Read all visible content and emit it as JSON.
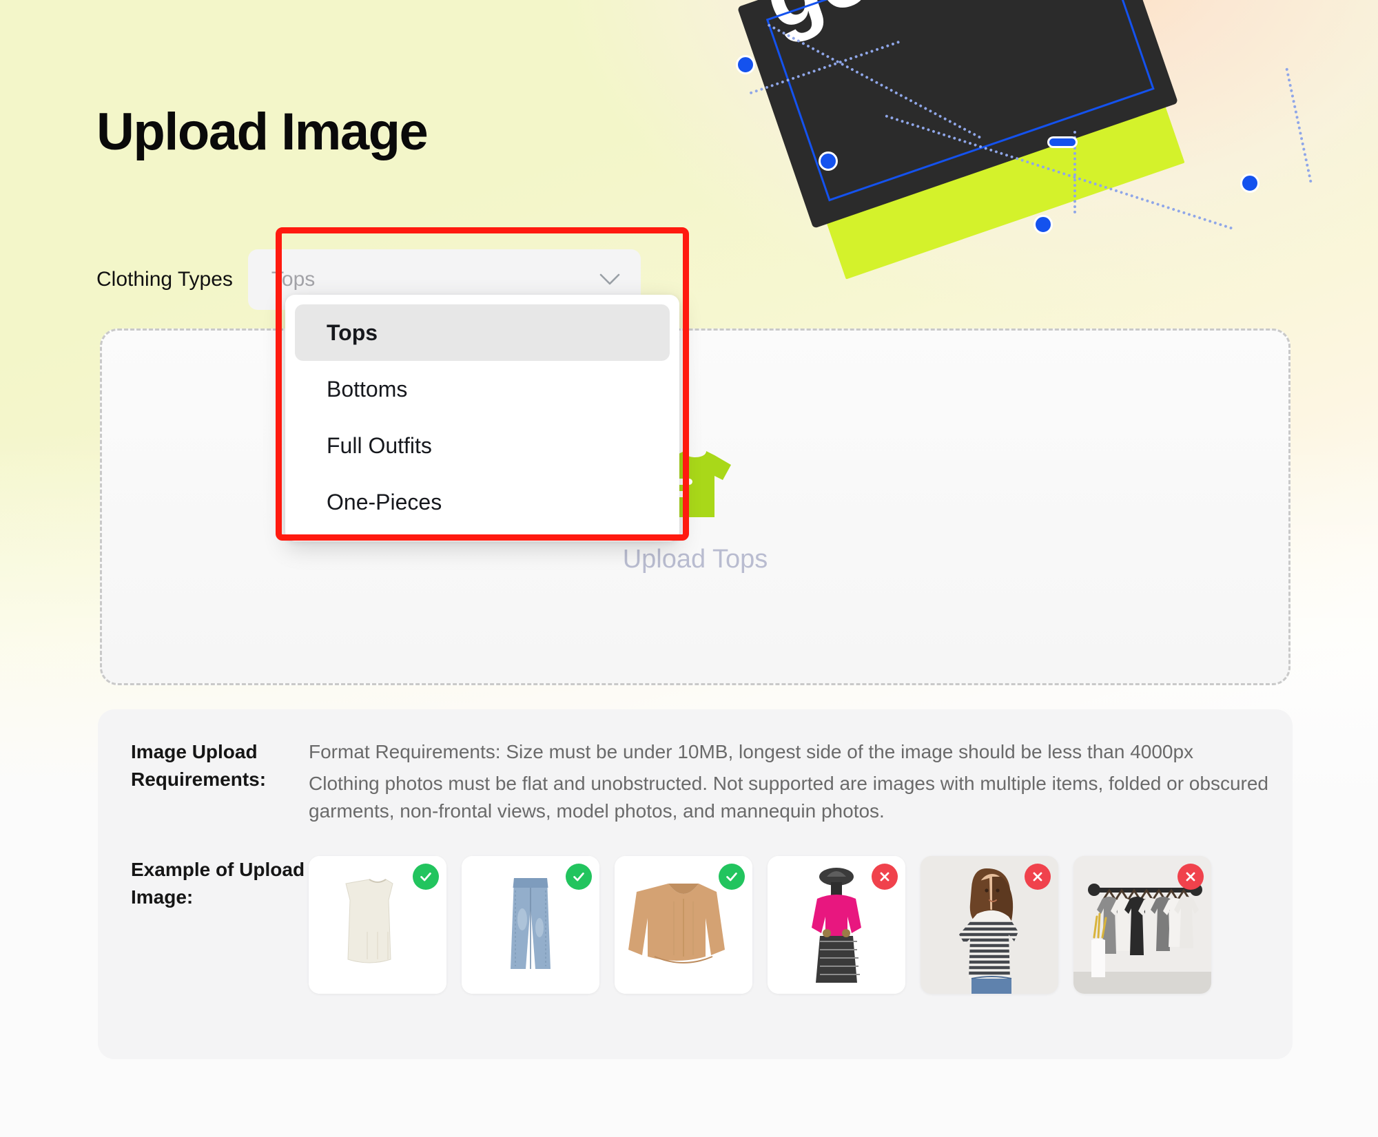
{
  "page": {
    "title": "Upload Image",
    "background_color": "#f2f5c8"
  },
  "decoration": {
    "card_text": "gener...",
    "lime_color": "#d4f22b",
    "dark_color": "#2b2b2b",
    "handle_color": "#1452ee",
    "guide_color": "#8fa6e8",
    "name": "rotated-design-card"
  },
  "clothing_type_field": {
    "label": "Clothing Types",
    "selected_value": "Tops",
    "placeholder": "Tops",
    "chevron_icon": "chevron-down-icon",
    "highlight_color": "#ff1a0f"
  },
  "dropdown": {
    "open": true,
    "options": [
      {
        "label": "Tops",
        "selected": true
      },
      {
        "label": "Bottoms",
        "selected": false
      },
      {
        "label": "Full Outfits",
        "selected": false
      },
      {
        "label": "One-Pieces",
        "selected": false
      }
    ]
  },
  "dropzone": {
    "label": "Upload Tops",
    "icon": "tshirt-upload-icon",
    "icon_color": "#a9d819",
    "border_style": "dashed"
  },
  "info_panel": {
    "requirements_key": "Image Upload Requirements:",
    "requirements_lines": [
      "Format Requirements: Size must be under 10MB, longest side of the image should be less than 4000px",
      "Clothing photos must be flat and unobstructed. Not supported are images with multiple items, folded or obscured garments, non-frontal views, model photos, and mannequin photos."
    ],
    "examples_key": "Example of Upload Image:",
    "examples": [
      {
        "name": "white-sleeveless-dress",
        "status": "ok",
        "badge_icon": "check-icon"
      },
      {
        "name": "blue-jeans",
        "status": "ok",
        "badge_icon": "check-icon"
      },
      {
        "name": "tan-v-neck-sweater",
        "status": "ok",
        "badge_icon": "check-icon"
      },
      {
        "name": "mannequin-pink-sweater",
        "status": "no",
        "badge_icon": "cross-icon"
      },
      {
        "name": "model-striped-tee",
        "status": "no",
        "badge_icon": "cross-icon"
      },
      {
        "name": "clothing-rack-multiple-items",
        "status": "no",
        "badge_icon": "cross-icon"
      }
    ]
  }
}
